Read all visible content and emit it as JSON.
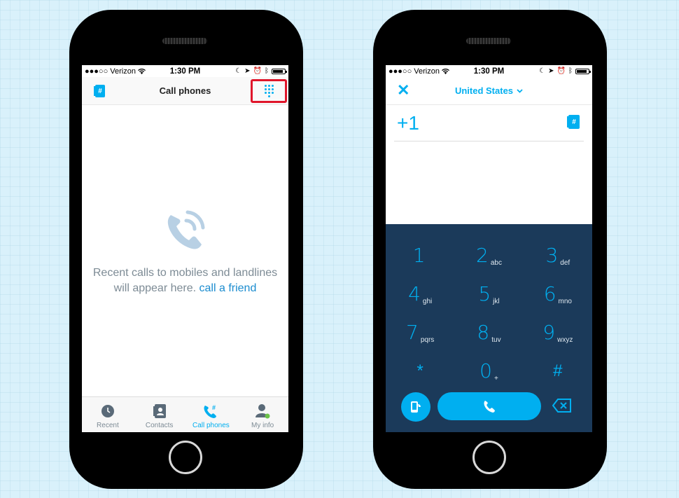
{
  "status": {
    "carrier": "●●●○○ Verizon",
    "time": "1:30 PM"
  },
  "left_screen": {
    "nav_title": "Call phones",
    "contacts_book_glyph": "#",
    "empty_line1": "Recent calls to mobiles and landlines",
    "empty_line2": "will appear here.",
    "empty_link": "call a friend",
    "tabs": [
      {
        "label": "Recent",
        "icon": "clock-icon"
      },
      {
        "label": "Contacts",
        "icon": "contacts-icon"
      },
      {
        "label": "Call phones",
        "icon": "call-phones-icon"
      },
      {
        "label": "My info",
        "icon": "my-info-icon"
      }
    ]
  },
  "right_screen": {
    "country": "United States",
    "number": "+1",
    "contacts_book_glyph": "#",
    "keys": [
      {
        "digit": "1",
        "letters": ""
      },
      {
        "digit": "2",
        "letters": "abc"
      },
      {
        "digit": "3",
        "letters": "def"
      },
      {
        "digit": "4",
        "letters": "ghi"
      },
      {
        "digit": "5",
        "letters": "jkl"
      },
      {
        "digit": "6",
        "letters": "mno"
      },
      {
        "digit": "7",
        "letters": "pqrs"
      },
      {
        "digit": "8",
        "letters": "tuv"
      },
      {
        "digit": "9",
        "letters": "wxyz"
      },
      {
        "digit": "*",
        "letters": ""
      },
      {
        "digit": "0",
        "letters": "+"
      },
      {
        "digit": "#",
        "letters": ""
      }
    ]
  },
  "colors": {
    "accent": "#00aff0",
    "keypad_bg": "#1b3a5a",
    "highlight": "#e0162b"
  }
}
